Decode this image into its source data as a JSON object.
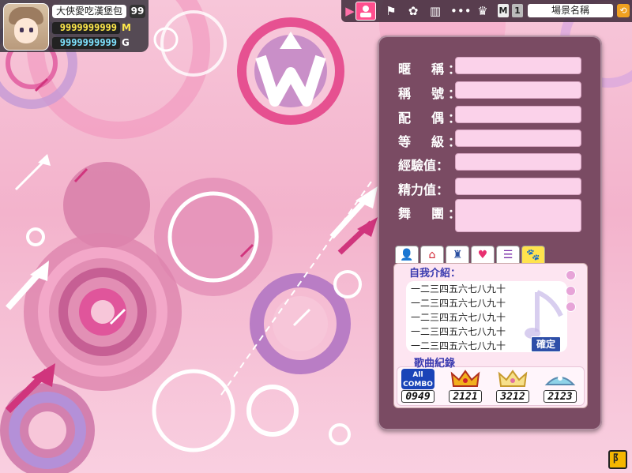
{
  "player": {
    "name": "大俠愛吃漢堡包",
    "level": "99",
    "money": "9999999999",
    "money_unit": "M",
    "gold": "9999999999",
    "gold_unit": "G"
  },
  "topbar": {
    "mode_m": "M",
    "mode_1": "1",
    "scene_name": "場景名稱",
    "icons": [
      "play-arrow-icon",
      "profile-icon",
      "flag-icon",
      "paw-icon",
      "book-icon",
      "dots-icon",
      "trophy-icon",
      "exit-icon"
    ]
  },
  "profile": {
    "fields": [
      {
        "label": "暱　稱：",
        "value": ""
      },
      {
        "label": "稱　號：",
        "value": ""
      },
      {
        "label": "配　偶：",
        "value": ""
      },
      {
        "label": "等　級：",
        "value": ""
      },
      {
        "label": "經驗值：",
        "value": ""
      },
      {
        "label": "精力值：",
        "value": ""
      },
      {
        "label": "舞　團：",
        "value": ""
      }
    ],
    "tabs": [
      {
        "icon": "person-icon",
        "glyph": "👤"
      },
      {
        "icon": "house-icon",
        "glyph": "⌂"
      },
      {
        "icon": "outfit-icon",
        "glyph": "♜"
      },
      {
        "icon": "heart-icon",
        "glyph": "♥"
      },
      {
        "icon": "list-icon",
        "glyph": "☰"
      },
      {
        "icon": "paw-icon",
        "glyph": "🐾"
      }
    ],
    "intro_title": "自我介紹：",
    "intro_lines": [
      "一二三四五六七八九十",
      "一二三四五六七八九十",
      "一二三四五六七八九十",
      "一二三四五六七八九十",
      "一二三四五六七八九十"
    ],
    "confirm_label": "確定",
    "songs_title": "歌曲紀錄",
    "song_records": [
      {
        "badge": "all-combo-badge",
        "badge_text": "All COMBO",
        "score": "0949"
      },
      {
        "badge": "gold-crown-badge",
        "badge_text": "",
        "score": "2121"
      },
      {
        "badge": "silver-crown-badge",
        "badge_text": "",
        "score": "3212"
      },
      {
        "badge": "tiara-badge",
        "badge_text": "",
        "score": "2123"
      }
    ]
  },
  "colors": {
    "accent": "#ff4f8e",
    "panel": "#7a4b63",
    "field": "#fbd2ea",
    "title_blue": "#3b3bb0"
  }
}
